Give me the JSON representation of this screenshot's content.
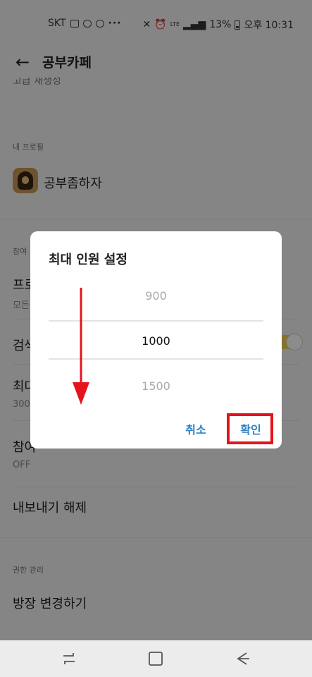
{
  "status_bar": {
    "carrier": "SKT",
    "more": "···",
    "lte": "LTE",
    "battery": "13%",
    "time": "오후 10:31"
  },
  "app_bar": {
    "title": "공부카페"
  },
  "settings": {
    "clipped_top_text": "고급 재생성",
    "my_profile_label": "내 프로필",
    "profile_name": "공부좀하자",
    "participation_label": "참여",
    "row_profile_title": "프로",
    "row_profile_sub": "모든",
    "row_search_title": "검색",
    "row_max_title": "최대",
    "row_max_sub": "300",
    "row_participant_title": "참여",
    "row_participant_sub": "OFF",
    "row_export_title": "내보내기 해제",
    "admin_label": "권한 관리",
    "row_owner_title": "방장 변경하기"
  },
  "dialog": {
    "title": "최대 인원 설정",
    "picker": {
      "previous": "900",
      "selected": "1000",
      "next": "1500"
    },
    "cancel_label": "취소",
    "confirm_label": "확인"
  },
  "colors": {
    "accent_blue": "#2e83c4",
    "highlight_red": "#e5131b",
    "toggle_yellow": "#f4d34a"
  }
}
